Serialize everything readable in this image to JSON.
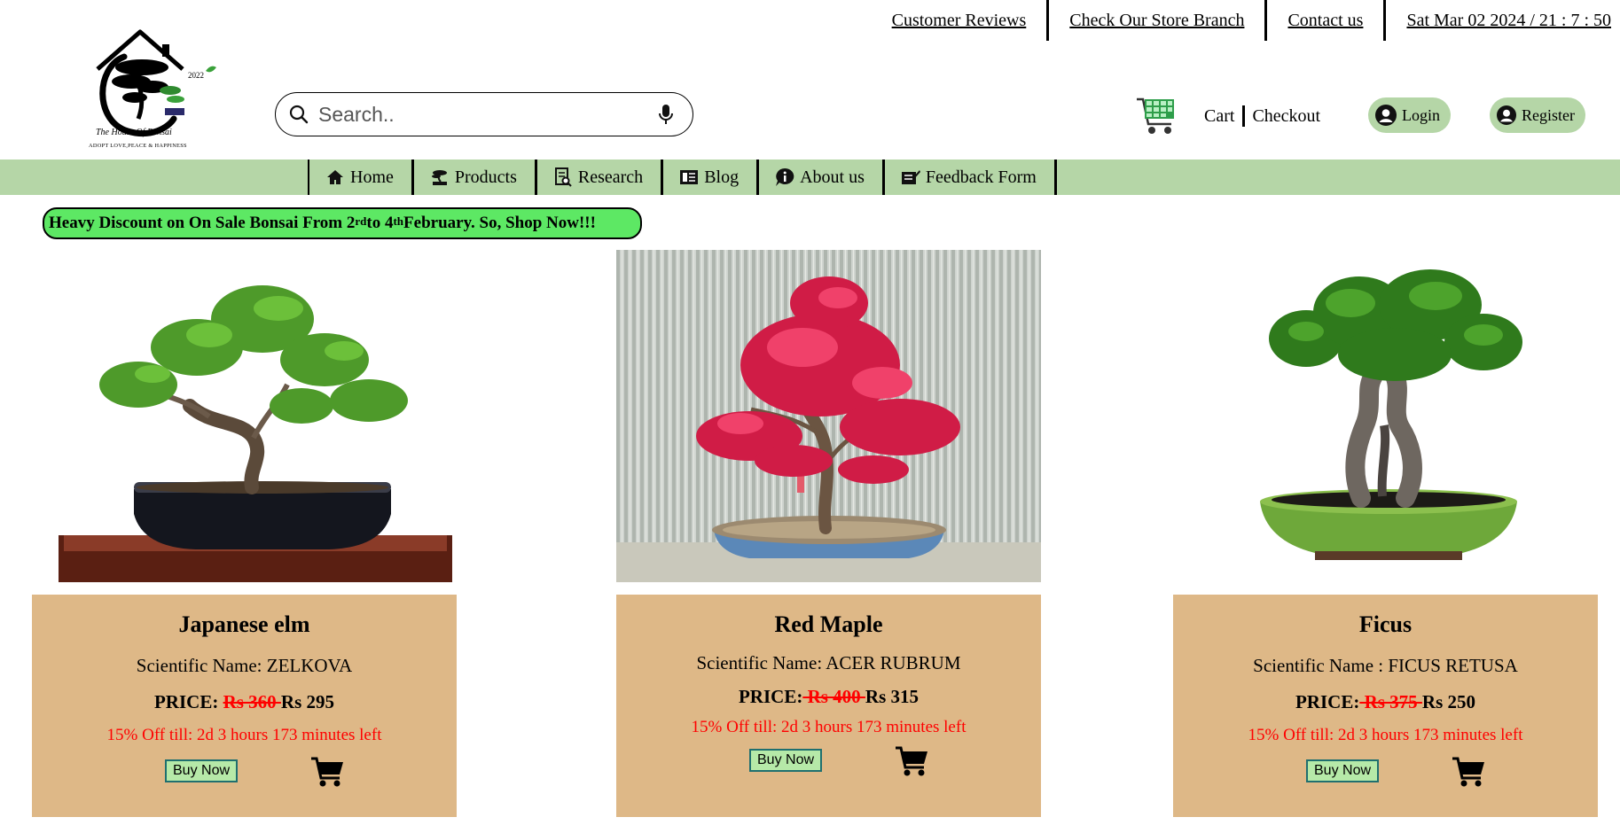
{
  "header": {
    "logo_text": "The House Of Bonsai",
    "logo_tagline": "ADOPT LOVE,PEACE & HAPPINESS",
    "logo_year": "2022",
    "top_links": [
      "Customer Reviews",
      "Check Our Store Branch",
      "Contact us"
    ],
    "datetime": "Sat Mar 02 2024 / 21 : 7 : 50",
    "search_placeholder": "Search..",
    "cart_label": "Cart",
    "checkout_label": "Checkout",
    "login_label": "Login",
    "register_label": "Register"
  },
  "nav": {
    "items": [
      {
        "label": "Home",
        "icon": "home-icon"
      },
      {
        "label": "Products",
        "icon": "bonsai-icon"
      },
      {
        "label": "Research",
        "icon": "research-icon"
      },
      {
        "label": "Blog",
        "icon": "blog-icon"
      },
      {
        "label": "About us",
        "icon": "info-icon"
      },
      {
        "label": "Feedback Form",
        "icon": "feedback-icon"
      }
    ]
  },
  "banner": {
    "part1": "Heavy Discount on On Sale Bonsai From 2",
    "sup1": "rd",
    "part2": " to 4",
    "sup2": "th",
    "part3": " February. So, Shop Now!!!"
  },
  "products": [
    {
      "name": "Japanese elm",
      "scientific": "Scientific Name: ZELKOVA",
      "price_label": "PRICE: ",
      "old_price": "Rs 360 ",
      "new_price": "Rs 295",
      "offer": "15% Off till: 2d 3 hours 173 minutes left",
      "buy_label": "Buy Now"
    },
    {
      "name": "Red Maple",
      "scientific": "Scientific Name: ACER RUBRUM",
      "price_label": "PRICE:",
      "old_price": " Rs 400 ",
      "new_price": "Rs 315",
      "offer": "15% Off till: 2d 3 hours 173 minutes left",
      "buy_label": "Buy Now"
    },
    {
      "name": "Ficus",
      "scientific": "Scientific Name : FICUS RETUSA",
      "price_label": "PRICE:",
      "old_price": " Rs 375 ",
      "new_price": "Rs 250",
      "offer": "15% Off till: 2d 3 hours 173 minutes left",
      "buy_label": "Buy Now"
    }
  ],
  "colors": {
    "nav_bg": "#b5d6a7",
    "banner_bg": "#5de864",
    "card_bg": "#deb887",
    "sale_red": "#ff0000",
    "buy_bg": "#b6e9a8"
  }
}
